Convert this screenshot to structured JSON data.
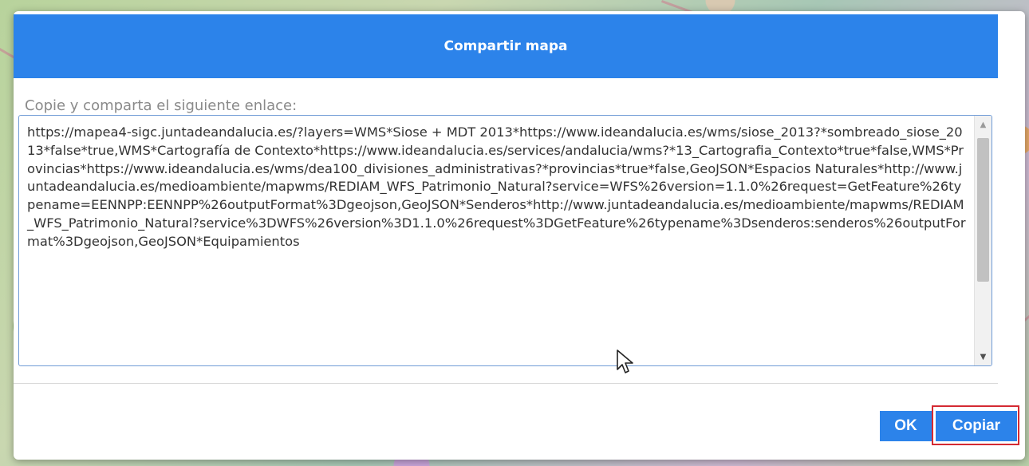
{
  "dialog": {
    "title": "Compartir mapa",
    "subtitle": "Copie y comparta el siguiente enlace:",
    "link": "https://mapea4-sigc.juntadeandalucia.es/?layers=WMS*Siose + MDT 2013*https://www.ideandalucia.es/wms/siose_2013?*sombreado_siose_2013*false*true,WMS*Cartografía de Contexto*https://www.ideandalucia.es/services/andalucia/wms?*13_Cartografia_Contexto*true*false,WMS*Provincias*https://www.ideandalucia.es/wms/dea100_divisiones_administrativas?*provincias*true*false,GeoJSON*Espacios Naturales*http://www.juntadeandalucia.es/medioambiente/mapwms/REDIAM_WFS_Patrimonio_Natural?service=WFS%26version=1.1.0%26request=GetFeature%26typename=EENNPP:EENNPP%26outputFormat%3Dgeojson,GeoJSON*Senderos*http://www.juntadeandalucia.es/medioambiente/mapwms/REDIAM_WFS_Patrimonio_Natural?service%3DWFS%26version%3D1.1.0%26request%3DGetFeature%26typename%3Dsenderos:senderos%26outputFormat%3Dgeojson,GeoJSON*Equipamientos",
    "ok_label": "OK",
    "copy_label": "Copiar"
  },
  "colors": {
    "header_bg": "#2c83ea",
    "button_bg": "#2c83ea",
    "highlight_border": "#d42a32"
  }
}
